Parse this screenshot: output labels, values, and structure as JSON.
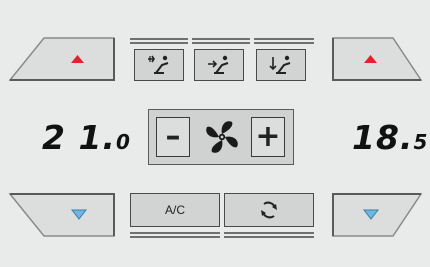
{
  "controls": {
    "temp_left": {
      "main": "2 1.",
      "decimal": "0"
    },
    "temp_right": {
      "main": "18.",
      "decimal": "5"
    },
    "fan": {
      "minus_label": "–",
      "plus_label": "+"
    },
    "ac_label": "A/C"
  },
  "icons": {
    "temp_up": "triangle-up-red",
    "temp_down": "triangle-down-blue",
    "mode_face": "airflow-face-icon",
    "mode_body": "airflow-body-icon",
    "mode_feet": "airflow-feet-icon",
    "fan": "fan-icon",
    "recirculate": "recirculation-icon"
  },
  "colors": {
    "panel_bg": "#e9ebeb",
    "button_face": "#d2d3d3",
    "arrow_up": "#e5202e",
    "arrow_down": "#6fb6e2"
  }
}
